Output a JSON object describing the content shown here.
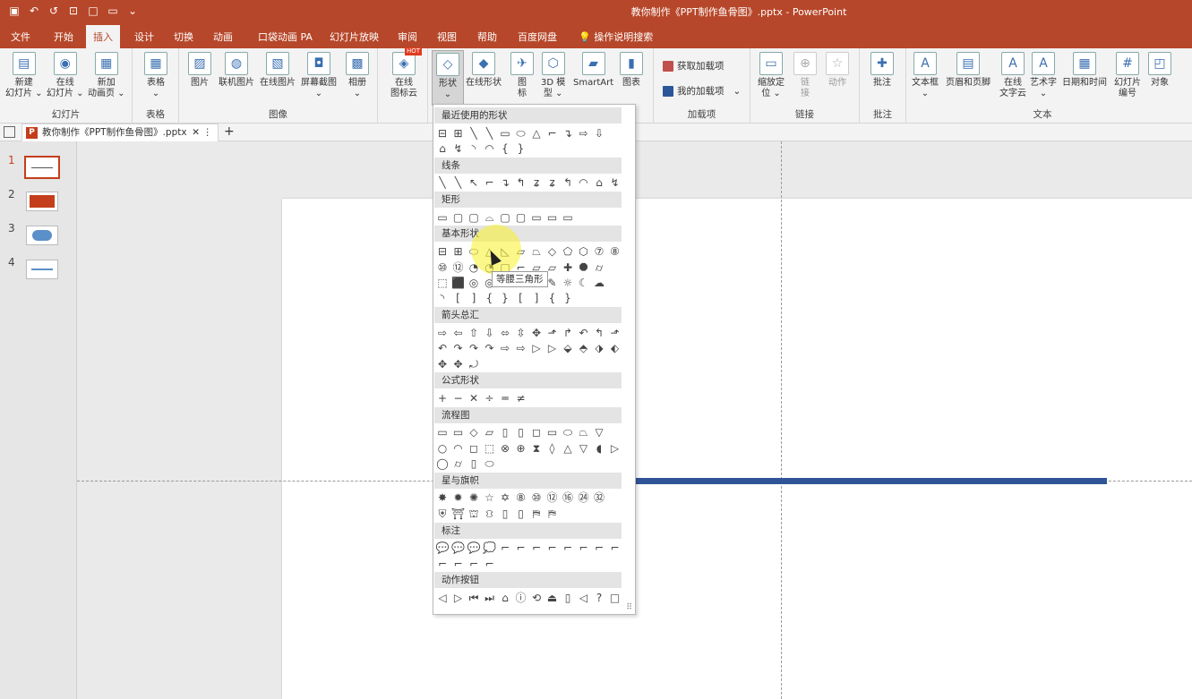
{
  "titlebar": {
    "title": "教你制作《PPT制作鱼骨图》.pptx - PowerPoint",
    "qat_icons": [
      "save-icon",
      "undo-icon",
      "redo-icon",
      "present-icon",
      "new-file-icon",
      "open-icon",
      "customize-icon"
    ],
    "qat_glyphs": [
      "▣",
      "↶",
      "↺",
      "⊡",
      "□",
      "▭",
      "⌄"
    ]
  },
  "tabs": [
    "文件",
    "开始",
    "插入",
    "设计",
    "切换",
    "动画",
    "口袋动画 PA",
    "幻灯片放映",
    "审阅",
    "视图",
    "帮助",
    "百度网盘",
    "操作说明搜索"
  ],
  "ribbon": {
    "slides": {
      "label": "幻灯片",
      "new_slide": "新建\n幻灯片 ⌄",
      "online_slide": "在线\n幻灯片 ⌄",
      "new_animation_page": "新加\n动画页 ⌄"
    },
    "table": {
      "label": "表格",
      "table": "表格\n⌄"
    },
    "images": {
      "label": "图像",
      "picture": "图片",
      "online_picture": "联机图片",
      "online_picture2": "在线图片",
      "screenshot": "屏幕截图\n⌄",
      "album": "相册\n⌄"
    },
    "icons_cloud": {
      "label": "在线\n图标云",
      "badge": "HOT"
    },
    "illustrations": {
      "shapes": "形状\n⌄",
      "online_shapes": "在线形状",
      "icons": "图\n标",
      "models_3d": "3D 模\n型 ⌄",
      "smartart": "SmartArt",
      "chart": "图表"
    },
    "addins": {
      "label": "加载项",
      "get_addins": "获取加载项",
      "my_addins": "我的加载项   ⌄"
    },
    "links": {
      "label": "链接",
      "zoom": "缩放定\n位 ⌄",
      "link": "链\n接",
      "action": "动作"
    },
    "comments": {
      "label": "批注",
      "comment": "批注"
    },
    "text": {
      "label": "文本",
      "textbox": "文本框\n⌄",
      "header_footer": "页眉和页脚",
      "online_text_cloud": "在线\n文字云",
      "wordart": "艺术字\n⌄",
      "datetime": "日期和时间",
      "slide_number": "幻灯片\n编号",
      "object": "对象"
    }
  },
  "filetab": {
    "name": "教你制作《PPT制作鱼骨图》.pptx",
    "close": "✕",
    "more": "⋮",
    "add": "+"
  },
  "thumbnails": [
    "1",
    "2",
    "3",
    "4"
  ],
  "shapes_menu": {
    "categories": [
      "最近使用的形状",
      "线条",
      "矩形",
      "基本形状",
      "箭头总汇",
      "公式形状",
      "流程图",
      "星与旗帜",
      "标注",
      "动作按钮"
    ],
    "rows": [
      "⊟⊞╲╲▭⬭△⌐↴⇨⇩",
      "⌂↯◝◠{}",
      "╲╲↖⌐↴↰ʑʑ↰◠⌂↯",
      "▭▢▢⌓▢▢▭▭▭",
      "⊟⊞⬭△◺▱⏢◇⬠⬡⑦⑧",
      "⑩⑫◔◔□⌐▱▱✚⯃⌭",
      "⬚⬛◎◎  ♡✎☼☾☁",
      "◝[]{}[]{}",
      "⇨⇦⇧⇩⬄⇳✥⬏↱↶↰⬏",
      "↶↷↷↷⇨⇨▷▷⬙⬘⬗⬖",
      "✥✥⤾",
      "+−✕÷═≠",
      "▭▭◇▱▯▯◻▭⬭⏢▽",
      "○◠◻⬚⊗⊕⧗◊△▽◖▷",
      "◯⌭▯⬭",
      "✸✹✺☆✡⑧⑩⑫⑯㉔㉜",
      "⛨⛩⛫⛻▯▯⛿⛿",
      "💬💬💬💭⌐⌐⌐⌐⌐⌐⌐⌐",
      "⌐⌐⌐⌐",
      "◁▷⏮⏭⌂ⓘ⟲⏏▯◁?□"
    ],
    "tooltip": "等腰三角形"
  }
}
